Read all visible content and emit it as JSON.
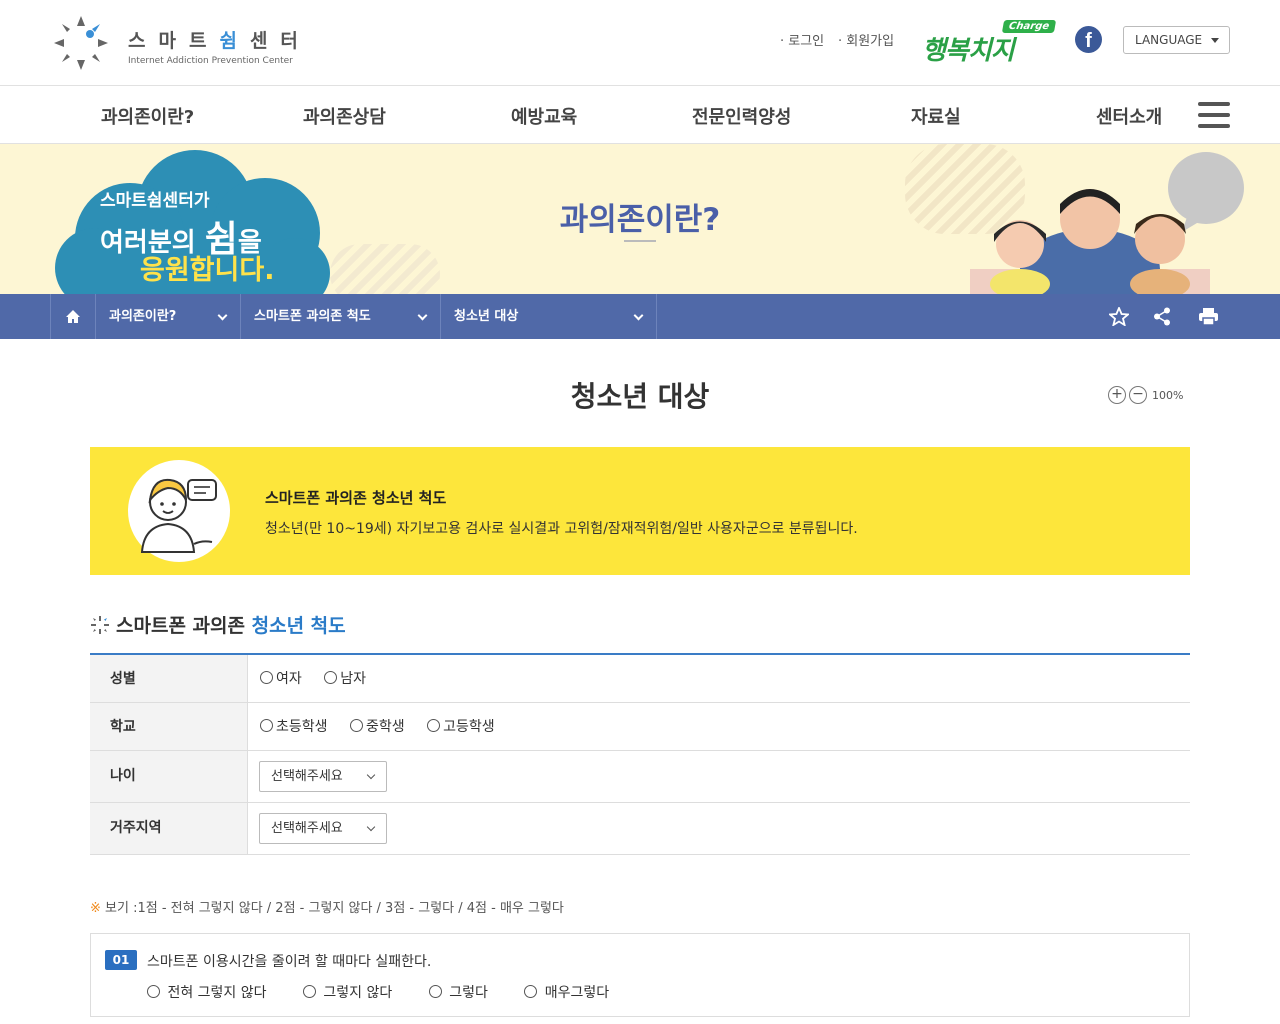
{
  "header": {
    "logo_title": "스마트쉼센터",
    "logo_title_pre": "스마트",
    "logo_title_hl": "쉼",
    "logo_title_post": "센터",
    "logo_sub": "Internet Addiction Prevention Center",
    "login": "· 로그인",
    "join": "· 회원가입",
    "happy_charge": "Charge",
    "happy_main": "행복치지",
    "facebook_icon": "f",
    "language": "LANGUAGE"
  },
  "gnb": [
    "과의존이란?",
    "과의존상담",
    "예방교육",
    "전문인력양성",
    "자료실",
    "센터소개"
  ],
  "visual": {
    "cloud_line1": "스마트쉼센터가",
    "cloud_line2_a": "여러분의",
    "cloud_line2_b": "쉼",
    "cloud_line2_c": "을",
    "cloud_line3": "응원합니다.",
    "title": "과의존이란?"
  },
  "location": {
    "depth1": "과의존이란?",
    "depth2": "스마트폰 과의존 척도",
    "depth3": "청소년 대상"
  },
  "content": {
    "page_title": "청소년 대상",
    "zoom_plus": "+",
    "zoom_minus": "−",
    "zoom_value": "100%",
    "notice_title": "스마트폰 과의존 청소년 척도",
    "notice_desc": "청소년(만 10~19세) 자기보고용 검사로 실시결과 고위험/잠재적위험/일반 사용자군으로 분류됩니다.",
    "section_title_pre": "스마트폰 과의존",
    "section_title_hl": "청소년 척도"
  },
  "form": {
    "gender_label": "성별",
    "gender_options": [
      "여자",
      "남자"
    ],
    "school_label": "학교",
    "school_options": [
      "초등학생",
      "중학생",
      "고등학생"
    ],
    "age_label": "나이",
    "age_select": "선택해주세요",
    "region_label": "거주지역",
    "region_select": "선택해주세요"
  },
  "legend": {
    "mark": "※",
    "text": "보기 :1점 - 전혀 그렇지 않다 / 2점 - 그렇지 않다 / 3점 - 그렇다 / 4점 - 매우 그렇다"
  },
  "question1": {
    "num": "01",
    "text": "스마트폰 이용시간을 줄이려 할 때마다 실패한다.",
    "options": [
      "전혀 그렇지 않다",
      "그렇지 않다",
      "그렇다",
      "매우그렇다"
    ]
  },
  "colors": {
    "nav_blue": "#5069a8",
    "notice_yellow": "#fde63b",
    "accent_blue": "#2a7bc8",
    "banner_bg": "#fdf6d4"
  }
}
